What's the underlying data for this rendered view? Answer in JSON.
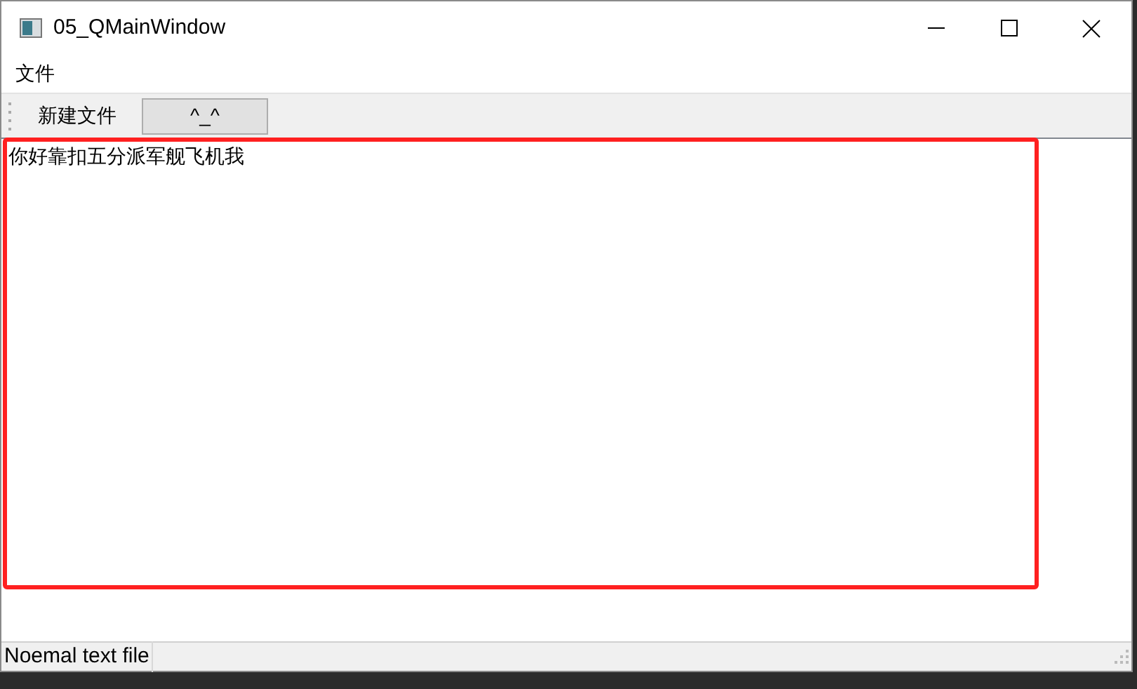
{
  "window": {
    "title": "05_QMainWindow"
  },
  "menu": [
    "文件"
  ],
  "toolbar": [
    {
      "label": "新建文件",
      "kind": "action"
    },
    {
      "label": "^_^",
      "kind": "button"
    }
  ],
  "editor": {
    "value": "你好靠扣五分派军舰飞机我",
    "highlighted": true
  },
  "status_bar": {
    "message": "Noemal text file"
  }
}
